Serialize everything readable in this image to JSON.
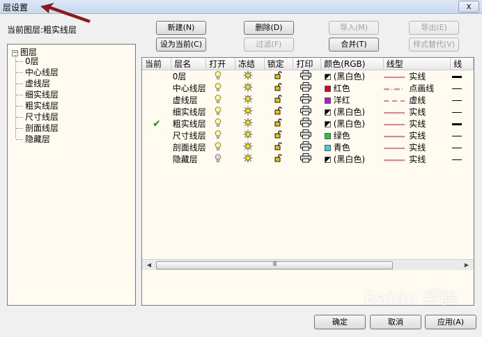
{
  "window": {
    "title": "层设置",
    "close_label": "x"
  },
  "current_layer_label": "当前图层:粗实线层",
  "buttons": {
    "new": "新建(N)",
    "delete": "删除(D)",
    "import": "导入(M)",
    "export": "导出(E)",
    "set_current": "设为当前(C)",
    "filter": "过滤(F)",
    "merge": "合并(T)",
    "style_replace": "样式替代(V)",
    "ok": "确定",
    "cancel": "取消",
    "apply": "应用(A)"
  },
  "tree": {
    "root": "图层",
    "root_box": "−",
    "items": [
      "0层",
      "中心线层",
      "虚线层",
      "细实线层",
      "粗实线层",
      "尺寸线层",
      "剖面线层",
      "隐藏层"
    ]
  },
  "table": {
    "headers": [
      "当前",
      "层名",
      "打开",
      "冻结",
      "锁定",
      "打印",
      "颜色(RGB)",
      "线型",
      "线"
    ],
    "rows": [
      {
        "current": "",
        "name": "0层",
        "open": true,
        "color_name": "(黑白色)",
        "color": "bw",
        "linetype": "实线",
        "lt_style": "solid",
        "lw": 3
      },
      {
        "current": "",
        "name": "中心线层",
        "open": true,
        "color_name": "红色",
        "color": "#e0001a",
        "linetype": "点画线",
        "lt_style": "dashdot",
        "lw": 1
      },
      {
        "current": "",
        "name": "虚线层",
        "open": true,
        "color_name": "洋红",
        "color": "#d000ff",
        "linetype": "虚线",
        "lt_style": "dashed",
        "lw": 1
      },
      {
        "current": "",
        "name": "细实线层",
        "open": true,
        "color_name": "(黑白色)",
        "color": "bw",
        "linetype": "实线",
        "lt_style": "solid",
        "lw": 1
      },
      {
        "current": "✔",
        "name": "粗实线层",
        "open": true,
        "color_name": "(黑白色)",
        "color": "bw",
        "linetype": "实线",
        "lt_style": "solid",
        "lw": 3
      },
      {
        "current": "",
        "name": "尺寸线层",
        "open": true,
        "color_name": "绿色",
        "color": "#22c84a",
        "linetype": "实线",
        "lt_style": "solid",
        "lw": 1
      },
      {
        "current": "",
        "name": "剖面线层",
        "open": true,
        "color_name": "青色",
        "color": "#22dcec",
        "linetype": "实线",
        "lt_style": "solid",
        "lw": 1
      },
      {
        "current": "",
        "name": "隐藏层",
        "open": false,
        "color_name": "(黑白色)",
        "color": "bw",
        "linetype": "实线",
        "lt_style": "solid",
        "lw": 1
      }
    ]
  },
  "scroll": {
    "left_arrow": "◀",
    "right_arrow": "▶",
    "grip": "III"
  },
  "colors": {
    "line_red": "#e0001a",
    "tree_bg": "#fffbf0"
  },
  "watermark": "Baidu 经验"
}
